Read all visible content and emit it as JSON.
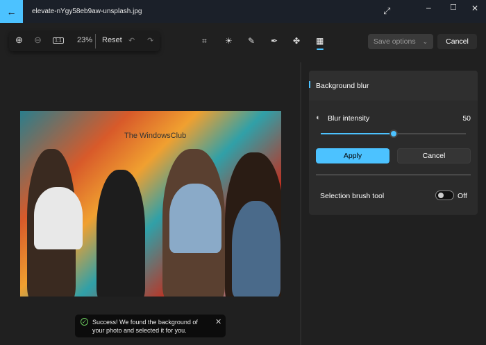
{
  "titlebar": {
    "filename": "elevate-nYgy58eb9aw-unsplash.jpg"
  },
  "zoombar": {
    "zoom_level": "23%",
    "reset_label": "Reset"
  },
  "toolbar": {
    "save_options_label": "Save options",
    "cancel_label": "Cancel",
    "active_tool": "background-blur"
  },
  "photo": {
    "watermark": "The WindowsClub"
  },
  "panel": {
    "title": "Background blur",
    "blur_label": "Blur intensity",
    "blur_value": "50",
    "blur_fraction": 0.5,
    "apply_label": "Apply",
    "cancel_label": "Cancel",
    "brush_label": "Selection brush tool",
    "brush_state": "Off"
  },
  "toast": {
    "message": "Success! We found the background of your photo and selected it for you."
  },
  "colors": {
    "accent": "#4cc2ff",
    "success": "#6ccb5f"
  }
}
